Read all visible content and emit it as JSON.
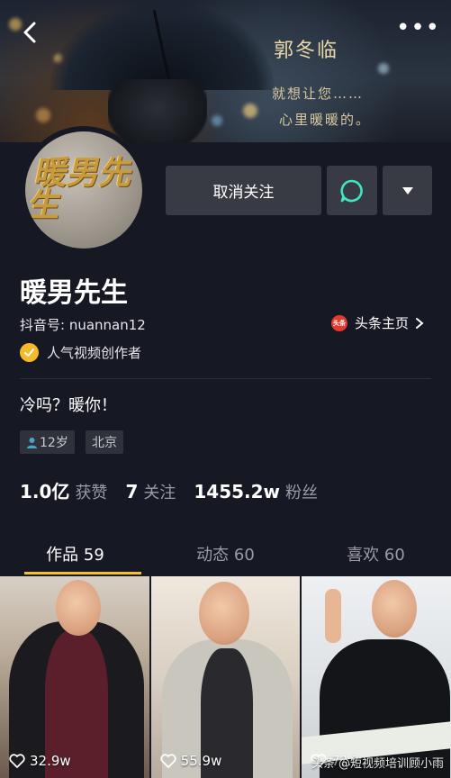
{
  "banner": {
    "title": "郭冬临",
    "line1": "就想让您……",
    "line2": "心里暖暖的。"
  },
  "header": {
    "more_label": "•••"
  },
  "actions": {
    "unfollow_label": "取消关注"
  },
  "profile": {
    "avatar_text": "暖男先生",
    "nickname": "暖男先生",
    "douyin_id": "抖音号: nuannan12",
    "toutiao_badge": "头条",
    "toutiao_label": "头条主页",
    "creator_label": "人气视频创作者",
    "bio": "冷吗？暖你！",
    "tags": {
      "age": "12岁",
      "city": "北京"
    }
  },
  "stats": [
    {
      "value": "1.0亿",
      "label": "获赞"
    },
    {
      "value": "7",
      "label": "关注"
    },
    {
      "value": "1455.2w",
      "label": "粉丝"
    }
  ],
  "tabs": [
    {
      "label": "作品 59",
      "active": true
    },
    {
      "label": "动态 60",
      "active": false
    },
    {
      "label": "喜欢 60",
      "active": false
    }
  ],
  "videos": [
    {
      "likes": "32.9w"
    },
    {
      "likes": "55.9w"
    },
    {
      "likes": "7?.?"
    }
  ],
  "watermark": "头条 @短视频培训顾小雨",
  "colors": {
    "background": "#161823",
    "button": "#393b44",
    "accent": "#f8c21b",
    "chat_icon": "#3ee6c3",
    "creator_badge": "#f5b92a",
    "toutiao": "#e23a2e"
  }
}
